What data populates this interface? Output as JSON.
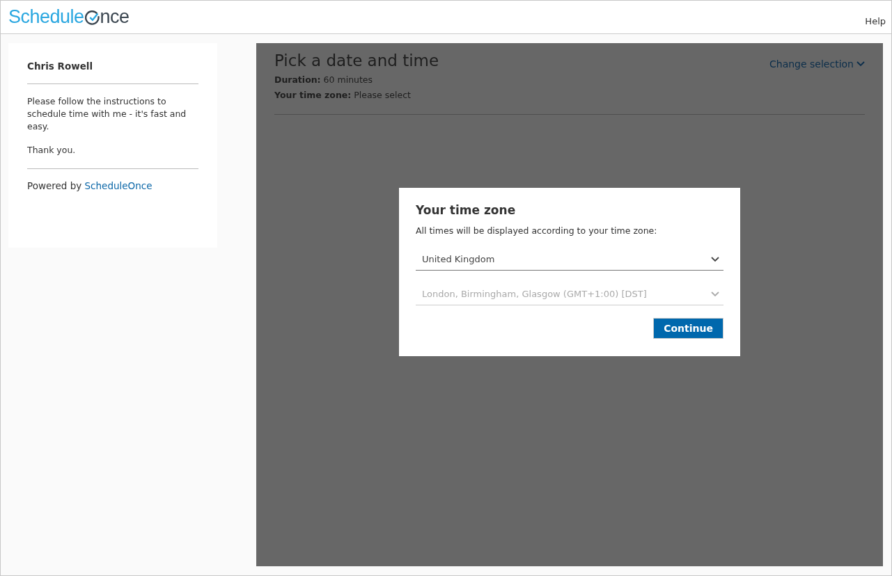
{
  "header": {
    "logo": {
      "first": "Schedule",
      "last": "nce"
    },
    "help_link": "Help"
  },
  "sidebar": {
    "name": "Chris Rowell",
    "message": "Please follow the instructions to schedule time with me - it's fast and easy.",
    "thanks": "Thank you.",
    "powered_by": "Powered by",
    "powered_link": "ScheduleOnce"
  },
  "main": {
    "title": "Pick a date and time",
    "change_selection": "Change selection",
    "details": [
      {
        "label": "Duration:",
        "value": "60 minutes"
      },
      {
        "label": "Your time zone:",
        "value": "Please select"
      }
    ]
  },
  "dialog": {
    "title": "Your time zone",
    "description": "All times will be displayed according to your time zone:",
    "selects": [
      {
        "value": "United Kingdom",
        "disabled": false
      },
      {
        "value": "London, Birmingham, Glasgow (GMT+1:00) [DST]",
        "disabled": true
      }
    ],
    "button": "Continue"
  }
}
